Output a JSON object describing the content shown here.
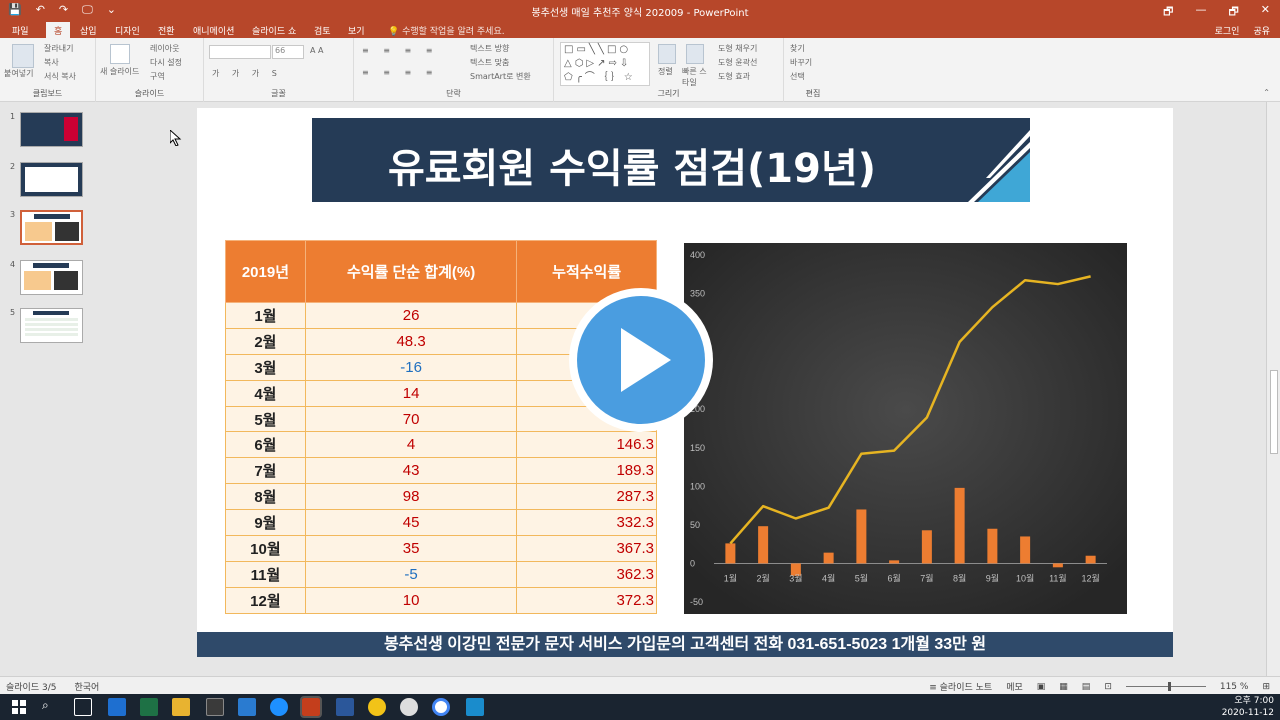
{
  "window": {
    "title": "봉추선생 매일 추천주 양식 202009 - PowerPoint",
    "controls": [
      "🗗",
      "—",
      "🗗",
      "✕"
    ]
  },
  "qat": {
    "save": "💾",
    "undo": "↶",
    "redo": "↷",
    "present": "🖵",
    "more": "⌄"
  },
  "tabs": [
    {
      "label": "파일",
      "active": false
    },
    {
      "label": "홈",
      "active": true
    },
    {
      "label": "삽입",
      "active": false
    },
    {
      "label": "디자인",
      "active": false
    },
    {
      "label": "전환",
      "active": false
    },
    {
      "label": "애니메이션",
      "active": false
    },
    {
      "label": "슬라이드 쇼",
      "active": false
    },
    {
      "label": "검토",
      "active": false
    },
    {
      "label": "보기",
      "active": false
    }
  ],
  "tell_me": "💡 수행할 작업을 알려 주세요.",
  "account": {
    "login": "로그인",
    "share": "공유"
  },
  "ribbon": {
    "clipboard": {
      "paste": "붙여넣기",
      "cut": "잘라내기",
      "copy": "복사",
      "format_painter": "서식 복사",
      "label": "클립보드"
    },
    "slides": {
      "new_slide": "새 슬라이드",
      "layout": "레이아웃",
      "reset": "다시 설정",
      "section": "구역",
      "label": "슬라이드"
    },
    "font": {
      "size": "66",
      "label": "글꼴"
    },
    "paragraph": {
      "text_direction": "텍스트 방향",
      "align_text": "텍스트 맞춤",
      "smartart": "SmartArt로 변환",
      "label": "단락"
    },
    "drawing": {
      "arrange": "정렬",
      "quick_styles": "빠른 스타일",
      "fill": "도형 채우기",
      "outline": "도형 윤곽선",
      "effects": "도형 효과",
      "label": "그리기"
    },
    "editing": {
      "find": "찾기",
      "replace": "바꾸기",
      "select": "선택",
      "label": "편집"
    }
  },
  "thumbnails": [
    {
      "num": "1",
      "active": false
    },
    {
      "num": "2",
      "active": false
    },
    {
      "num": "3",
      "active": true
    },
    {
      "num": "4",
      "active": false
    },
    {
      "num": "5",
      "active": false
    }
  ],
  "slide": {
    "title": "유료회원 수익률 점검(19년)",
    "table": {
      "headers": [
        "2019년",
        "수익률 단순 합계(%)",
        "누적수익률"
      ],
      "rows": [
        {
          "month": "1월",
          "value": "26",
          "cum": "",
          "neg": false
        },
        {
          "month": "2월",
          "value": "48.3",
          "cum": "",
          "neg": false
        },
        {
          "month": "3월",
          "value": "-16",
          "cum": "",
          "neg": true
        },
        {
          "month": "4월",
          "value": "14",
          "cum": "",
          "neg": false
        },
        {
          "month": "5월",
          "value": "70",
          "cum": "",
          "neg": false
        },
        {
          "month": "6월",
          "value": "4",
          "cum": "146.3",
          "neg": false
        },
        {
          "month": "7월",
          "value": "43",
          "cum": "189.3",
          "neg": false
        },
        {
          "month": "8월",
          "value": "98",
          "cum": "287.3",
          "neg": false
        },
        {
          "month": "9월",
          "value": "45",
          "cum": "332.3",
          "neg": false
        },
        {
          "month": "10월",
          "value": "35",
          "cum": "367.3",
          "neg": false
        },
        {
          "month": "11월",
          "value": "-5",
          "cum": "362.3",
          "neg": true
        },
        {
          "month": "12월",
          "value": "10",
          "cum": "372.3",
          "neg": false
        }
      ]
    },
    "footer": "봉추선생 이강민 전문가 문자 서비스 가입문의 고객센터  전화 031-651-5023  1개월 33만 원"
  },
  "chart_data": {
    "type": "bar",
    "categories": [
      "1월",
      "2월",
      "3월",
      "4월",
      "5월",
      "6월",
      "7월",
      "8월",
      "9월",
      "10월",
      "11월",
      "12월"
    ],
    "series": [
      {
        "type": "bar",
        "values": [
          26,
          48.3,
          -16,
          14,
          70,
          4,
          43,
          98,
          45,
          35,
          -5,
          10
        ],
        "color": "#ed7d31"
      },
      {
        "type": "line",
        "values": [
          26,
          74.3,
          58.3,
          72.3,
          142.3,
          146.3,
          189.3,
          287.3,
          332.3,
          367.3,
          362.3,
          372.3
        ],
        "color": "#e6b422"
      }
    ],
    "ylim": [
      -50,
      400
    ],
    "yticks": [
      "400",
      "350",
      "300",
      "250",
      "200",
      "150",
      "100",
      "50",
      "0",
      "-50"
    ],
    "grid": false,
    "background": "#2b2b2b"
  },
  "statusbar": {
    "slide_info": "슬라이드 3/5",
    "language": "한국어",
    "notes": "≡ 슬라이드 노트",
    "comments": "메모",
    "zoom": "115 %"
  },
  "clock": {
    "time": "오후 7:00",
    "date": "2020-11-12"
  },
  "colors": {
    "accent": "#b7472a",
    "title_bar": "#253b56",
    "table_header": "#ed7d31",
    "footer": "#2f4a6a"
  }
}
